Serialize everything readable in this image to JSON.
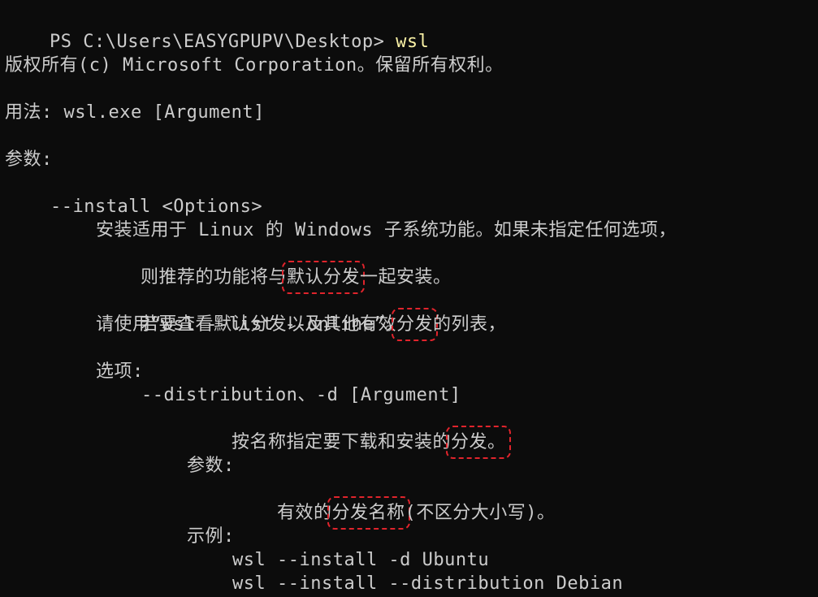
{
  "prompt": {
    "text": "PS C:\\Users\\EASYGPUPV\\Desktop> ",
    "command": "wsl"
  },
  "lines": {
    "copyright": "版权所有(c) Microsoft Corporation。保留所有权利。",
    "usage": "用法: wsl.exe [Argument]",
    "args_heading": "参数:",
    "install_flag": "--install <Options>",
    "install_desc_1": "安装适用于 Linux 的 Windows 子系统功能。如果未指定任何选项，",
    "install_desc_2a": "则推荐的功能将与",
    "install_desc_2b": "默认分发",
    "install_desc_2c": "一起安装。",
    "install_desc_3a": "若要查看默认分发以及其他有效",
    "install_desc_3b": "分发",
    "install_desc_3c": "的列表，",
    "install_desc_4": "请使用“wsl --list --online”。",
    "options_heading": "选项:",
    "distribution_flag": "--distribution、-d [Argument]",
    "distribution_desc_a": "按名称指定要下载和安装的",
    "distribution_desc_b": "分发。",
    "params_heading": "参数:",
    "params_desc_a": "有效的",
    "params_desc_b": "分发名称",
    "params_desc_c": "(不区分大小写)。",
    "examples_heading": "示例:",
    "example_1": "wsl --install -d Ubuntu",
    "example_2": "wsl --install --distribution Debian"
  },
  "colors": {
    "background": "#0c0c0c",
    "text": "#cccccc",
    "command": "#f9f1a5",
    "highlight_box": "#e0242c"
  }
}
